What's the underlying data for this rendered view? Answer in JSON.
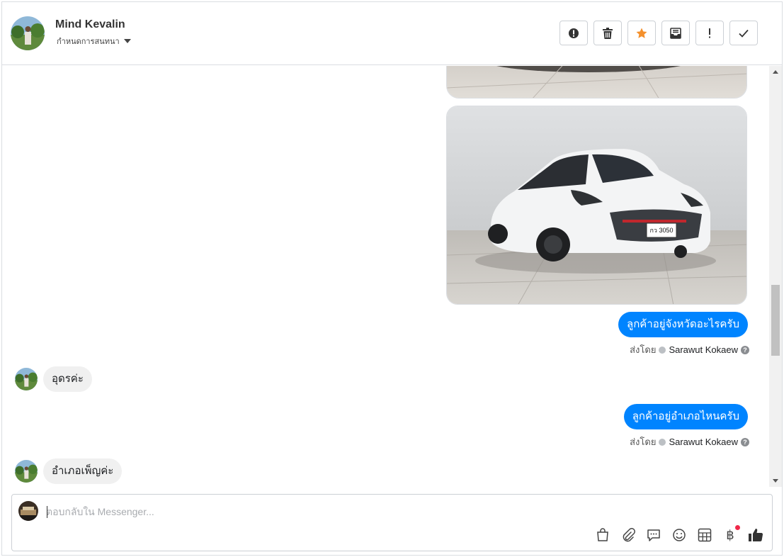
{
  "header": {
    "contact_name": "Mind Kevalin",
    "subtitle": "กำหนดการสนทนา",
    "actions": [
      {
        "name": "report",
        "icon": "alert-circle-icon"
      },
      {
        "name": "delete",
        "icon": "trash-icon"
      },
      {
        "name": "star",
        "icon": "star-icon",
        "color": "#f4902c"
      },
      {
        "name": "mark-unread",
        "icon": "inbox-icon"
      },
      {
        "name": "important",
        "icon": "exclamation-icon"
      },
      {
        "name": "done",
        "icon": "check-icon"
      }
    ]
  },
  "messages": [
    {
      "type": "image-partial",
      "direction": "out"
    },
    {
      "type": "image",
      "direction": "out",
      "plate_text": "กว 3050"
    },
    {
      "type": "text",
      "direction": "out",
      "text": "ลูกค้าอยู่จังหวัดอะไรครับ",
      "sent_by_label": "ส่งโดย",
      "sent_by": "Sarawut Kokaew"
    },
    {
      "type": "text",
      "direction": "in",
      "text": "อุดรค่ะ"
    },
    {
      "type": "text",
      "direction": "out",
      "text": "ลูกค้าอยู่อำเภอไหนครับ",
      "sent_by_label": "ส่งโดย",
      "sent_by": "Sarawut Kokaew"
    },
    {
      "type": "text",
      "direction": "in",
      "text": "อำเภอเพ็ญค่ะ"
    }
  ],
  "composer": {
    "placeholder": "ตอบกลับใน Messenger...",
    "value": "",
    "tools": [
      "shopping-bag-icon",
      "paperclip-icon",
      "chat-bubble-icon",
      "smiley-icon",
      "calculator-icon",
      "baht-icon",
      "thumbs-up-icon"
    ],
    "baht_symbol": "฿"
  },
  "colors": {
    "outgoing_bubble": "#0084ff",
    "incoming_bubble": "#f0f0f0",
    "star": "#f4902c",
    "notification_dot": "#f02849"
  }
}
